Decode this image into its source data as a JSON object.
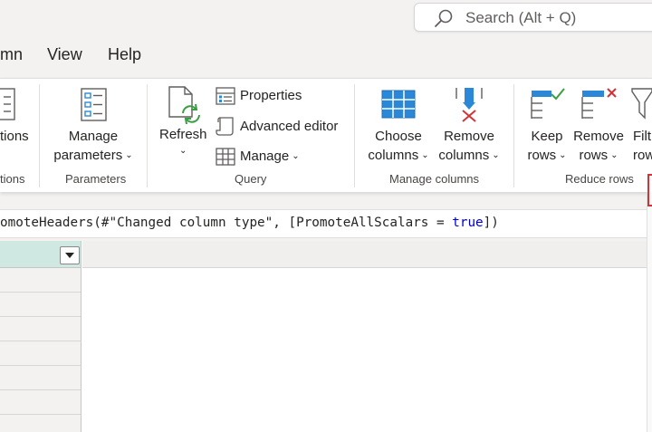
{
  "search": {
    "placeholder": "Search (Alt + Q)",
    "icon": "search-icon"
  },
  "menu": {
    "items": [
      "mn",
      "View",
      "Help"
    ]
  },
  "ribbon": {
    "partial_left": {
      "label": "tions",
      "group": "tions"
    },
    "parameters": {
      "button": [
        "Manage",
        "parameters"
      ],
      "group": "Parameters"
    },
    "query": {
      "refresh": "Refresh",
      "properties": "Properties",
      "advanced_editor": "Advanced editor",
      "manage": "Manage",
      "group": "Query"
    },
    "manage_columns": {
      "choose": [
        "Choose",
        "columns"
      ],
      "remove": [
        "Remove",
        "columns"
      ],
      "group": "Manage columns"
    },
    "reduce_rows": {
      "keep": [
        "Keep",
        "rows"
      ],
      "remove": [
        "Remove",
        "rows"
      ],
      "filter": [
        "Filt",
        "row"
      ],
      "group": "Reduce rows"
    }
  },
  "formula": {
    "prefix": "omoteHeaders(#\"Changed column type\", [PromoteAllScalars = ",
    "keyword": "true",
    "suffix": "])"
  },
  "colors": {
    "accent_blue": "#2b88d8",
    "column_header": "#cfe8e1",
    "remove_red": "#d13438",
    "keep_green": "#3a9e44"
  }
}
